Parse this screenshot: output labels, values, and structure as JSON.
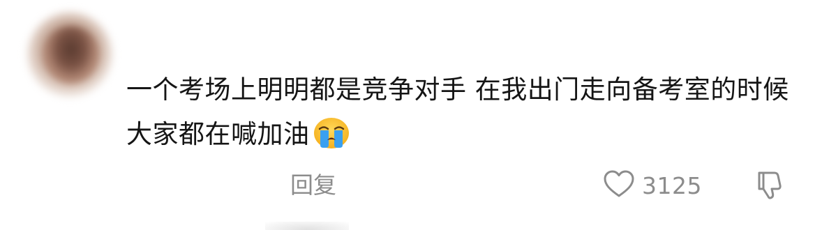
{
  "comment": {
    "text": "一个考场上明明都是竞争对手 在我出门走向备考室的时候大家都在喊加油",
    "emoji": "crying-face"
  },
  "actions": {
    "reply_label": "回复",
    "like_count": "3125"
  },
  "colors": {
    "text": "#151515",
    "muted": "#8c8c8c",
    "emoji_face": "#ffc83d",
    "emoji_tears": "#3aa0f0"
  }
}
